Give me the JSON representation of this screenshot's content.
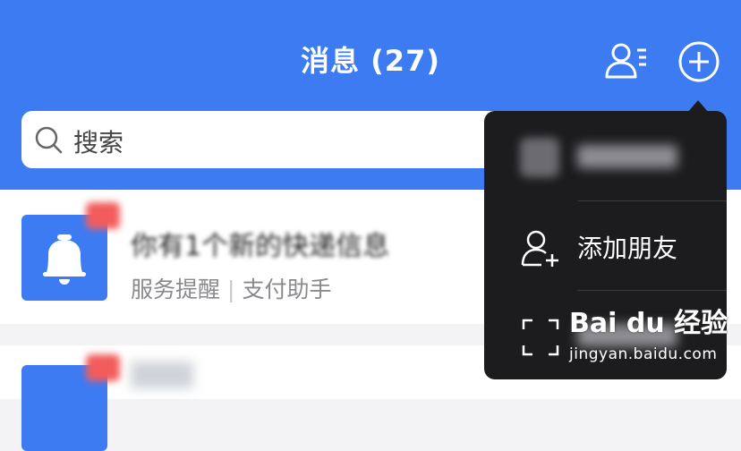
{
  "header": {
    "title": "消息 (27)",
    "icons": [
      "contacts-icon",
      "plus-circle-icon"
    ],
    "background_color": "#3d7bf2"
  },
  "search": {
    "placeholder": "搜索",
    "icon": "search-icon"
  },
  "messages": [
    {
      "icon": "bell-icon",
      "preview": "你有1个新的快递信息",
      "source_name": "服务提醒",
      "separator": "|",
      "source_app": "支付助手"
    },
    {
      "icon": "app-icon"
    }
  ],
  "popup_menu": {
    "items": [
      {
        "icon": "blurred-icon",
        "label": ""
      },
      {
        "icon": "add-friend-icon",
        "label": "添加朋友"
      },
      {
        "icon": "scan-icon",
        "label": ""
      }
    ],
    "background_color": "#1c1c1e"
  },
  "watermark": {
    "logo": "Bai du 经验",
    "url": "jingyan.baidu.com"
  }
}
